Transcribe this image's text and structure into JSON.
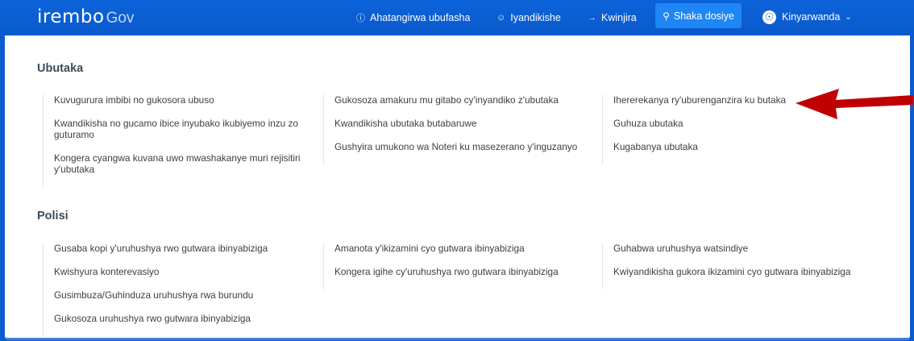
{
  "header": {
    "brand": "irembo",
    "brand_suffix": "Gov",
    "nav": [
      {
        "label": "Ahatangirwa ubufasha",
        "icon": "help-circle-icon"
      },
      {
        "label": "Iyandikishe",
        "icon": "user-plus-icon"
      },
      {
        "label": "Kwinjira",
        "icon": "sign-in-icon"
      }
    ],
    "search_label": "Shaka dosiye",
    "language": "Kinyarwanda"
  },
  "sections": [
    {
      "title": "Ubutaka",
      "columns": [
        [
          "Kuvugurura imbibi no gukosora ubuso",
          "Kwandikisha no gucamo ibice inyubako ikubiyemo inzu zo guturamo",
          "Kongera cyangwa kuvana uwo mwashakanye muri rejisitiri y'ubutaka"
        ],
        [
          "Gukosoza amakuru mu gitabo cy'inyandiko z'ubutaka",
          "Kwandikisha ubutaka butabaruwe",
          "Gushyira umukono wa Noteri ku masezerano y'inguzanyo"
        ],
        [
          "Ihererekanya ry'uburenganzira ku butaka",
          "Guhuza ubutaka",
          "Kugabanya ubutaka"
        ]
      ]
    },
    {
      "title": "Polisi",
      "columns": [
        [
          "Gusaba kopi y'uruhushya rwo gutwara ibinyabiziga",
          "Kwishyura konterevasiyo",
          "Gusimbuza/Guhinduza uruhushya rwa burundu",
          "Gukosoza uruhushya rwo gutwara ibinyabiziga"
        ],
        [
          "Amanota y'ikizamini cyo gutwara ibinyabiziga",
          "Kongera igihe cy'uruhushya rwo gutwara ibinyabiziga"
        ],
        [
          "Guhabwa uruhushya watsindiye",
          "Kwiyandikisha gukora ikizamini cyo gutwara ibinyabiziga"
        ]
      ]
    }
  ],
  "colors": {
    "header": "#0b5bcf",
    "search_button": "#1e86f5",
    "arrow": "#c00000"
  }
}
